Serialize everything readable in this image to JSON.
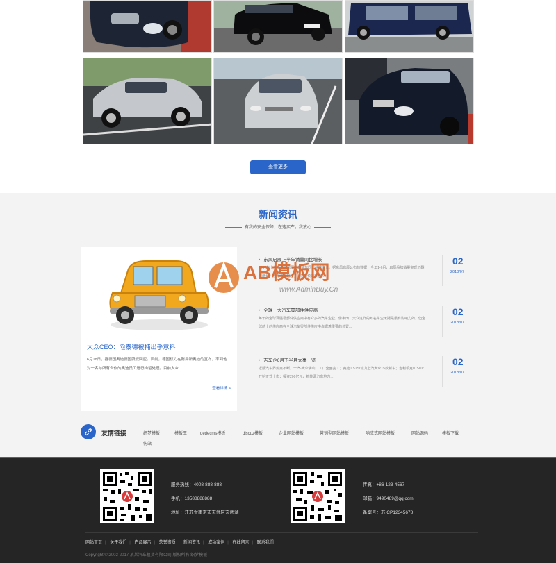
{
  "gallery": {
    "more_label": "查看更多"
  },
  "news": {
    "title": "新闻资讯",
    "subtitle": "有我的安全保障，在这买车，我放心",
    "feature": {
      "title": "大众CEO：险泰德被捕出乎意料",
      "text": "6月18日，据德国奥迪德国股权回应。面前，德国权力在财局新奥迪的宣布，率到他对一名与所有合作的奥迪员工进行拘留处理。目前大众...",
      "more": "查看详情 >"
    },
    "items": [
      {
        "title": "东风启辰上半年销量同比增长",
        "summary": "2017年上半年东风启辰销售整车同比快速增长。据东风启辰公布的数据，今年1-6月，启辰品牌销量实现了翻倍增长，领先增速超过了此前的预期目标...",
        "day": "02",
        "date": "2018/07"
      },
      {
        "title": "全球十大汽车零部件供应商",
        "summary": "每年的全球百强零部件供应商中有众多的汽车企业，像丰田、大众这样的知名车企无疑是最有影响力的，但全球前十的供应商在全球汽车零部件供应中占据着重要的位置...",
        "day": "02",
        "date": "2018/07"
      },
      {
        "title": "吉车企6月下半月大事一览",
        "summary": "近期汽车界热点不断，一汽-大众佛山二工厂全面完工；奥迪1.5TSI动力上汽大众15款新车；吉利领克01SUV开始正式上市；投资200亿元，新能源汽车地方...",
        "day": "02",
        "date": "2018/07"
      }
    ]
  },
  "watermark": {
    "brand": "AB模板网",
    "url": "www.AdminBuy.Cn"
  },
  "links": {
    "title": "友情链接",
    "items": [
      "织梦模板",
      "模板王",
      "dedecms模板",
      "discuz模板",
      "企业网站模板",
      "营销型网站模板",
      "响应式网站模板",
      "网站源码",
      "模板下载",
      "伤站"
    ]
  },
  "footer": {
    "hotline_label": "服务热线：",
    "hotline": "4008-888-888",
    "phone_label": "手机：",
    "phone": "13588888888",
    "address_label": "地址：",
    "address": "江苏省南京市玄武区玄武湖",
    "fax_label": "传真：",
    "fax": "+86-123-4567",
    "email_label": "邮箱：",
    "email": "9490489@qq.com",
    "icp_label": "备案号：",
    "icp": "苏ICP12345678",
    "nav": [
      "网站首页",
      "关于我们",
      "产品展示",
      "荣誉资质",
      "新闻资讯",
      "成功案例",
      "在线留言",
      "联系我们"
    ],
    "copyright": "Copyright © 2002-2017 某某汽车租赁有限公司 版权所有 织梦模板"
  },
  "colors": {
    "accent": "#2a66c9",
    "footer_bg": "#252525",
    "news_bg": "#f3f3f3"
  }
}
